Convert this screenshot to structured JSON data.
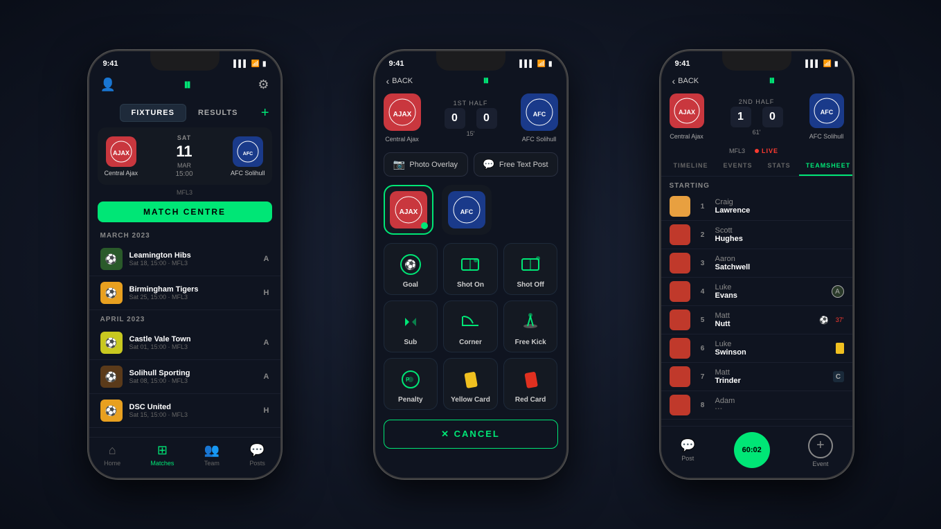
{
  "phones": [
    {
      "id": "phone1",
      "statusBar": {
        "time": "9:41",
        "signal": "▌▌▌",
        "wifi": "WiFi",
        "battery": "🔋"
      },
      "header": {
        "backLabel": null,
        "title": null,
        "settingsIcon": "⚙"
      },
      "tabs": [
        {
          "label": "FIXTURES",
          "active": true
        },
        {
          "label": "RESULTS",
          "active": false
        }
      ],
      "addButton": "+",
      "matchHero": {
        "team1": {
          "name": "Central Ajax",
          "emoji": "🔴"
        },
        "date": {
          "day": "SAT",
          "num": "11",
          "monthYear": "MAR",
          "time": "15:00"
        },
        "team2": {
          "name": "AFC Solihull",
          "emoji": "🔵"
        }
      },
      "matchCentreBtn": "MATCH CENTRE",
      "leagueLabel": "MFL3",
      "sections": [
        {
          "header": "MARCH 2023",
          "items": [
            {
              "name": "Leamington Hibs",
              "detail": "Sat 18, 15:00 · MFL3",
              "ha": "A",
              "emoji": "🟢"
            },
            {
              "name": "Birmingham Tigers",
              "detail": "Sat 25, 15:00 · MFL3",
              "ha": "H",
              "emoji": "🟡"
            }
          ]
        },
        {
          "header": "APRIL 2023",
          "items": [
            {
              "name": "Castle Vale Town",
              "detail": "Sat 01, 15:00 · MFL3",
              "ha": "A",
              "emoji": "🟡"
            },
            {
              "name": "Solihull Sporting",
              "detail": "Sat 08, 15:00 · MFL3",
              "ha": "A",
              "emoji": "🟤"
            },
            {
              "name": "DSC United",
              "detail": "Sat 15, 15:00 · MFL3",
              "ha": "H",
              "emoji": "🟡"
            }
          ]
        }
      ],
      "bottomNav": [
        {
          "label": "Home",
          "icon": "⌂",
          "active": false
        },
        {
          "label": "Matches",
          "icon": "⊞",
          "active": true
        },
        {
          "label": "Team",
          "icon": "👥",
          "active": false
        },
        {
          "label": "Posts",
          "icon": "💬",
          "active": false
        }
      ]
    },
    {
      "id": "phone2",
      "statusBar": {
        "time": "9:41",
        "signal": "▌▌▌",
        "wifi": "WiFi",
        "battery": "🔋"
      },
      "header": {
        "backLabel": "BACK"
      },
      "halfLabel": "1ST HALF",
      "score": {
        "home": "0",
        "away": "0",
        "time": "15'"
      },
      "team1": {
        "name": "Central Ajax",
        "emoji": "🔴"
      },
      "team2": {
        "name": "AFC Solihull",
        "emoji": "🔵"
      },
      "actions": [
        {
          "label": "Photo Overlay",
          "icon": "📷"
        },
        {
          "label": "Free Text Post",
          "icon": "💬"
        }
      ],
      "eventButtons": [
        {
          "label": "Goal",
          "icon": "⚽"
        },
        {
          "label": "Shot On",
          "icon": "🥅"
        },
        {
          "label": "Shot Off",
          "icon": "🥅"
        },
        {
          "label": "Sub",
          "icon": "↕"
        },
        {
          "label": "Corner",
          "icon": "⛳"
        },
        {
          "label": "Free Kick",
          "icon": "🦵"
        },
        {
          "label": "Penalty",
          "icon": "⚽"
        },
        {
          "label": "Yellow Card",
          "icon": "🟨"
        },
        {
          "label": "Red Card",
          "icon": "🟥"
        }
      ],
      "cancelBtn": "✕  CANCEL"
    },
    {
      "id": "phone3",
      "statusBar": {
        "time": "9:41",
        "signal": "▌▌▌",
        "wifi": "WiFi",
        "battery": "🔋"
      },
      "header": {
        "backLabel": "BACK"
      },
      "halfLabel": "2ND HALF",
      "score": {
        "home": "1",
        "away": "0",
        "time": "61'"
      },
      "team1": {
        "name": "Central Ajax",
        "emoji": "🔴"
      },
      "team2": {
        "name": "AFC Solihull",
        "emoji": "🔵"
      },
      "leagueLabel": "MFL3",
      "liveLabel": "LIVE",
      "tabs": [
        {
          "label": "TIMELINE",
          "active": false
        },
        {
          "label": "EVENTS",
          "active": false
        },
        {
          "label": "STATS",
          "active": false
        },
        {
          "label": "TEAMSHEET",
          "active": true
        }
      ],
      "startingHeader": "STARTING",
      "players": [
        {
          "num": 1,
          "firstName": "Craig",
          "lastName": "Lawrence",
          "badge": null,
          "avatar": "#e8a040"
        },
        {
          "num": 2,
          "firstName": "Scott",
          "lastName": "Hughes",
          "badge": null,
          "avatar": "#c0392b"
        },
        {
          "num": 3,
          "firstName": "Aaron",
          "lastName": "Satchwell",
          "badge": null,
          "avatar": "#c0392b"
        },
        {
          "num": 4,
          "firstName": "Luke",
          "lastName": "Evans",
          "badge": "A",
          "avatar": "#c0392b"
        },
        {
          "num": 5,
          "firstName": "Matt",
          "lastName": "Nutt",
          "badge": "⚽",
          "avatar": "#c0392b"
        },
        {
          "num": 6,
          "firstName": "Luke",
          "lastName": "Swinson",
          "badge": "🟨",
          "avatar": "#c0392b"
        },
        {
          "num": 7,
          "firstName": "Matt",
          "lastName": "Trinder",
          "badge": "C",
          "avatar": "#c0392b"
        },
        {
          "num": 8,
          "firstName": "Adam",
          "lastName": "···",
          "badge": null,
          "avatar": "#c0392b"
        }
      ],
      "bottomActions": [
        {
          "label": "Post",
          "icon": "💬"
        },
        {
          "label": "60:02",
          "isTimer": true
        },
        {
          "label": "Event",
          "icon": "+"
        }
      ]
    }
  ]
}
